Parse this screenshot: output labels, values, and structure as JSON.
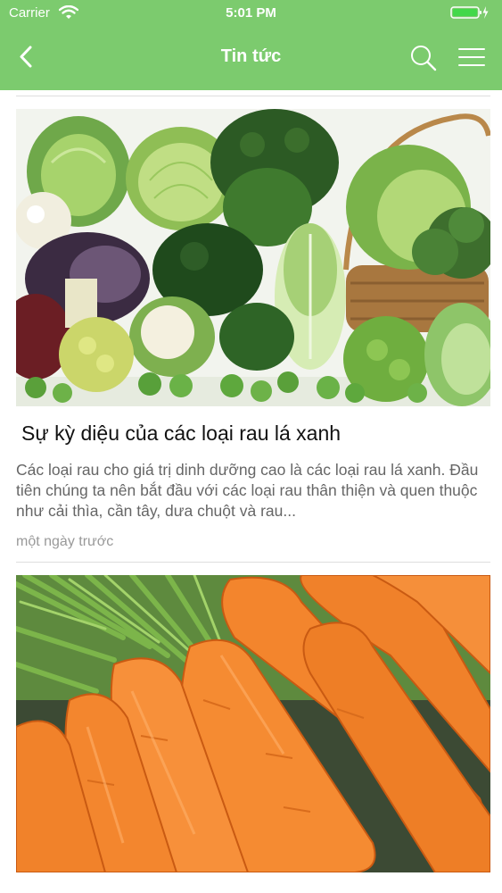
{
  "status": {
    "carrier": "Carrier",
    "time": "5:01 PM"
  },
  "nav": {
    "title": "Tin tức",
    "icons": [
      "back-chevron-icon",
      "search-icon",
      "hamburger-menu-icon"
    ]
  },
  "colors": {
    "header": "#7ccb6e",
    "summary_text": "#666666",
    "time_text": "#999999"
  },
  "articles": [
    {
      "image": "leafy-green-vegetables-photo",
      "title": "Sự kỳ diệu của các loại rau lá xanh",
      "summary": "Các loại rau cho giá trị dinh dưỡng cao là các loại rau lá xanh. Đầu tiên chúng ta nên bắt đầu với các loại rau thân thiện và quen thuộc như cải thìa, cần tây, dưa chuột và rau...",
      "time": "một ngày trước"
    },
    {
      "image": "carrots-photo",
      "title": "",
      "summary": "",
      "time": ""
    }
  ]
}
